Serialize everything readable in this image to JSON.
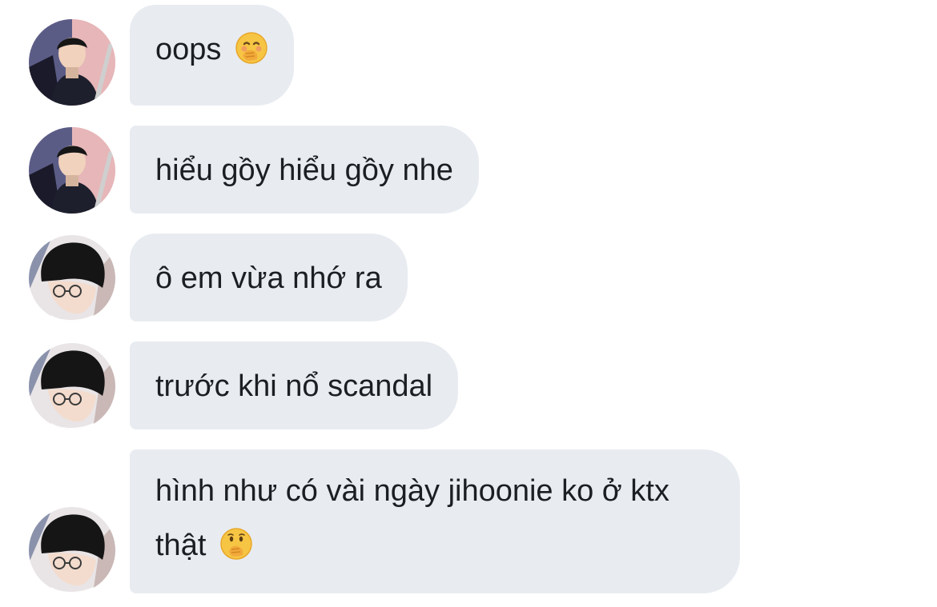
{
  "messages": [
    {
      "sender": "avatar-a",
      "text": "oops",
      "emoji": "face-with-hand-over-mouth"
    },
    {
      "sender": "avatar-a",
      "text": "hiểu gồy hiểu gồy nhe",
      "emoji": ""
    },
    {
      "sender": "avatar-b",
      "text": "ô em vừa nhớ ra",
      "emoji": ""
    },
    {
      "sender": "avatar-b",
      "text": "trước khi nổ scandal",
      "emoji": ""
    },
    {
      "sender": "avatar-b",
      "text": "hình như có vài ngày jihoonie ko ở ktx thật",
      "emoji": "face-with-hand-over-mouth"
    }
  ],
  "colors": {
    "bubble_bg": "#e8ecf1",
    "text": "#1b1f23",
    "background": "#ffffff"
  }
}
